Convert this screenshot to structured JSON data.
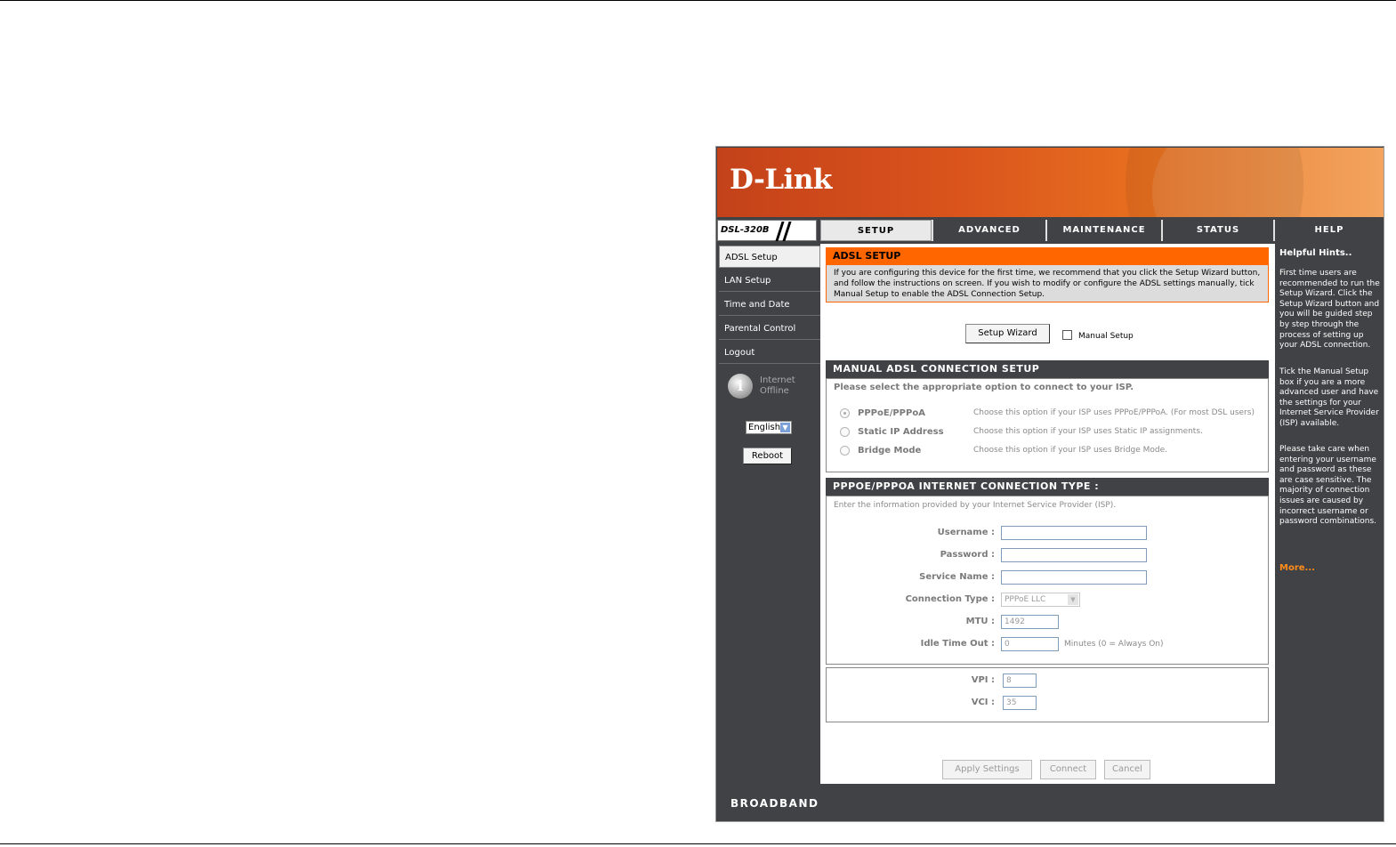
{
  "brand": {
    "logo_text": "D-Link",
    "model": "DSL-320B",
    "footer_text": "BROADBAND"
  },
  "tabs": [
    {
      "label": "SETUP",
      "active": true
    },
    {
      "label": "ADVANCED",
      "active": false
    },
    {
      "label": "MAINTENANCE",
      "active": false
    },
    {
      "label": "STATUS",
      "active": false
    },
    {
      "label": "HELP",
      "active": false
    }
  ],
  "sidebar": {
    "items": [
      {
        "label": "ADSL Setup",
        "active": true
      },
      {
        "label": "LAN Setup",
        "active": false
      },
      {
        "label": "Time and Date",
        "active": false
      },
      {
        "label": "Parental Control",
        "active": false
      },
      {
        "label": "Logout",
        "active": false
      }
    ],
    "internet_status_line1": "Internet",
    "internet_status_line2": "Offline",
    "language": "English",
    "reboot_label": "Reboot"
  },
  "adsl_setup": {
    "title": "ADSL SETUP",
    "description": "If you are configuring this device for the first time, we recommend that you click the Setup Wizard button, and follow the instructions on screen. If you wish to modify or configure the ADSL settings manually, tick Manual Setup to enable the ADSL Connection Setup.",
    "setup_wizard_label": "Setup Wizard",
    "manual_setup_label": "Manual Setup",
    "manual_setup_checked": false
  },
  "manual_connection": {
    "title": "MANUAL ADSL CONNECTION SETUP",
    "prompt": "Please select the appropriate option to connect to your ISP.",
    "options": [
      {
        "label": "PPPoE/PPPoA",
        "description": "Choose this option if your ISP uses PPPoE/PPPoA. (For most DSL users)",
        "selected": true
      },
      {
        "label": "Static IP Address",
        "description": "Choose this option if your ISP uses Static IP assignments.",
        "selected": false
      },
      {
        "label": "Bridge Mode",
        "description": "Choose this option if your ISP uses Bridge Mode.",
        "selected": false
      }
    ]
  },
  "pppoe": {
    "title": "PPPOE/PPPOA INTERNET CONNECTION TYPE :",
    "prompt": "Enter the information provided by your Internet Service Provider (ISP).",
    "username_label": "Username :",
    "username_value": "",
    "password_label": "Password :",
    "password_value": "",
    "service_name_label": "Service Name :",
    "service_name_value": "",
    "connection_type_label": "Connection Type :",
    "connection_type_value": "PPPoE LLC",
    "mtu_label": "MTU :",
    "mtu_value": "1492",
    "idle_label": "Idle Time Out :",
    "idle_value": "0",
    "idle_suffix": "Minutes (0 = Always On)"
  },
  "vpi_vci": {
    "vpi_label": "VPI :",
    "vpi_value": "8",
    "vci_label": "VCI :",
    "vci_value": "35"
  },
  "actions": {
    "apply_label": "Apply Settings",
    "connect_label": "Connect",
    "cancel_label": "Cancel"
  },
  "hints": {
    "title": "Helpful Hints..",
    "p1": "First time users are recommended to run the Setup Wizard. Click the Setup Wizard button and you will be guided step by step through the process of setting up your ADSL connection.",
    "p2": "Tick the Manual Setup box if you are a more advanced user and have the settings for your Internet Service Provider (ISP) available.",
    "p3": "Please take care when entering your username and password as these are case sensitive. The majority of connection issues are caused by incorrect username or password combinations.",
    "more": "More..."
  },
  "colors": {
    "accent": "#ff6600",
    "dark": "#404245"
  }
}
